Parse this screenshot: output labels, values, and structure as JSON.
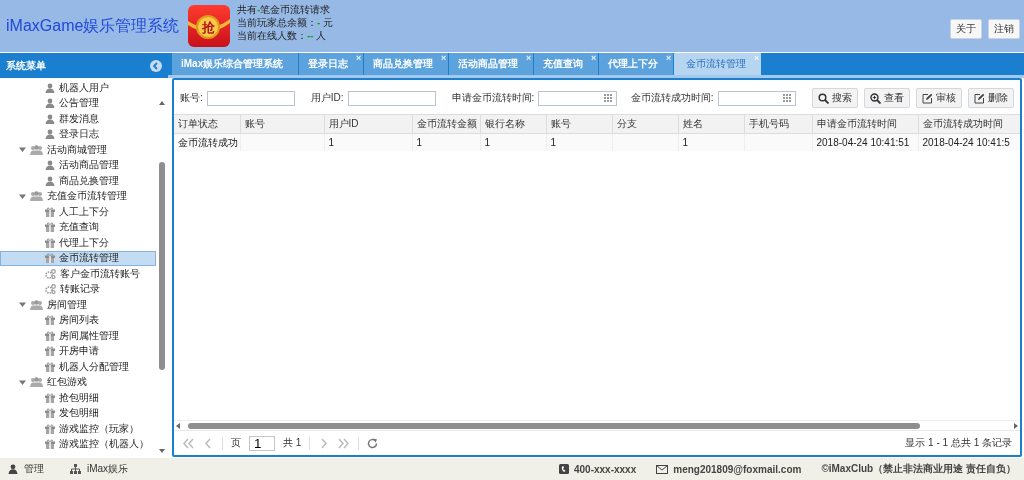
{
  "header": {
    "title": "iMaxGame娱乐管理系统",
    "logo_glyph": "抢",
    "stats": [
      {
        "before": "共有",
        "value": "-",
        "after": "笔金币流转请求"
      },
      {
        "before": "当前玩家总余额：",
        "value": "-",
        "after": " 元"
      },
      {
        "before": "当前在线人数：",
        "value": "--",
        "after": " 人"
      }
    ],
    "buttons": [
      "关于",
      "注销"
    ]
  },
  "sidebar": {
    "title": "系统菜单",
    "tree": [
      {
        "children": [
          {
            "label": "机器人用户",
            "kind": "user",
            "selected": false
          },
          {
            "label": "公告管理",
            "kind": "user",
            "selected": false
          },
          {
            "label": "群发消息",
            "kind": "user",
            "selected": false
          },
          {
            "label": "登录日志",
            "kind": "user",
            "selected": false
          }
        ]
      },
      {
        "label": "活动商城管理",
        "expanded": true,
        "children": [
          {
            "label": "活动商品管理",
            "kind": "user",
            "selected": false
          },
          {
            "label": "商品兑换管理",
            "kind": "user",
            "selected": false
          }
        ]
      },
      {
        "label": "充值金币流转管理",
        "expanded": true,
        "children": [
          {
            "label": "人工上下分",
            "kind": "gift",
            "selected": false
          },
          {
            "label": "充值查询",
            "kind": "gift",
            "selected": false
          },
          {
            "label": "代理上下分",
            "kind": "gift",
            "selected": false
          },
          {
            "label": "金币流转管理",
            "kind": "gift",
            "selected": true
          },
          {
            "label": "客户金币流转账号",
            "kind": "gears",
            "selected": false
          },
          {
            "label": "转账记录",
            "kind": "gears",
            "selected": false
          }
        ]
      },
      {
        "label": "房间管理",
        "expanded": true,
        "children": [
          {
            "label": "房间列表",
            "kind": "gift",
            "selected": false
          },
          {
            "label": "房间属性管理",
            "kind": "gift",
            "selected": false
          },
          {
            "label": "开房申请",
            "kind": "gift",
            "selected": false
          },
          {
            "label": "机器人分配管理",
            "kind": "gift",
            "selected": false
          }
        ]
      },
      {
        "label": "红包游戏",
        "expanded": true,
        "children": [
          {
            "label": "抢包明细",
            "kind": "gift",
            "selected": false
          },
          {
            "label": "发包明细",
            "kind": "gift",
            "selected": false
          },
          {
            "label": "游戏监控（玩家）",
            "kind": "gift",
            "selected": false
          },
          {
            "label": "游戏监控（机器人）",
            "kind": "gift",
            "selected": false
          }
        ]
      }
    ]
  },
  "tabs": [
    {
      "label": "iMax娱乐综合管理系统",
      "selected": false
    },
    {
      "label": "登录日志",
      "selected": false,
      "close": "×"
    },
    {
      "label": "商品兑换管理",
      "selected": false,
      "close": "×"
    },
    {
      "label": "活动商品管理",
      "selected": false,
      "close": "×"
    },
    {
      "label": "充值查询",
      "selected": false,
      "close": "×"
    },
    {
      "label": "代理上下分",
      "selected": false,
      "close": "×"
    },
    {
      "label": "金币流转管理",
      "selected": true,
      "close": "×"
    }
  ],
  "toolbar": {
    "fields": [
      {
        "label": "账号:",
        "kind": "text"
      },
      {
        "label": "用户ID:",
        "kind": "text"
      },
      {
        "label": "申请金币流转时间:",
        "kind": "date"
      },
      {
        "label": "金币流转成功时间:",
        "kind": "date"
      }
    ],
    "buttons": [
      {
        "label": "搜索",
        "kind": "search"
      },
      {
        "label": "查看",
        "kind": "zoom"
      },
      {
        "label": "审核",
        "kind": "edit"
      },
      {
        "label": "删除",
        "kind": "edit"
      }
    ]
  },
  "table": {
    "columns": [
      "订单状态",
      "账号",
      "用户ID",
      "金币流转金额",
      "银行名称",
      "账号",
      "分支",
      "姓名",
      "手机号码",
      "申请金币流转时间",
      "金币流转成功时间"
    ],
    "rows": [
      [
        "金币流转成功",
        null,
        "1",
        "1",
        "1",
        "1",
        null,
        "1",
        null,
        "2018-04-24 10:41:51",
        "2018-04-24 10:41:5"
      ]
    ]
  },
  "pager": {
    "page_label": "页",
    "page": "1",
    "total": "共 1",
    "summary": "显示 1 - 1 总共 1 条记录"
  },
  "footer": {
    "left": [
      {
        "label": "管理",
        "kind": "user"
      },
      {
        "label": "iMax娱乐",
        "kind": "sitemap"
      }
    ],
    "phone": "400-xxx-xxxx",
    "email": "meng201809@foxmail.com",
    "copyright": "©iMaxClub（禁止非法商业用途 责任自负）"
  }
}
